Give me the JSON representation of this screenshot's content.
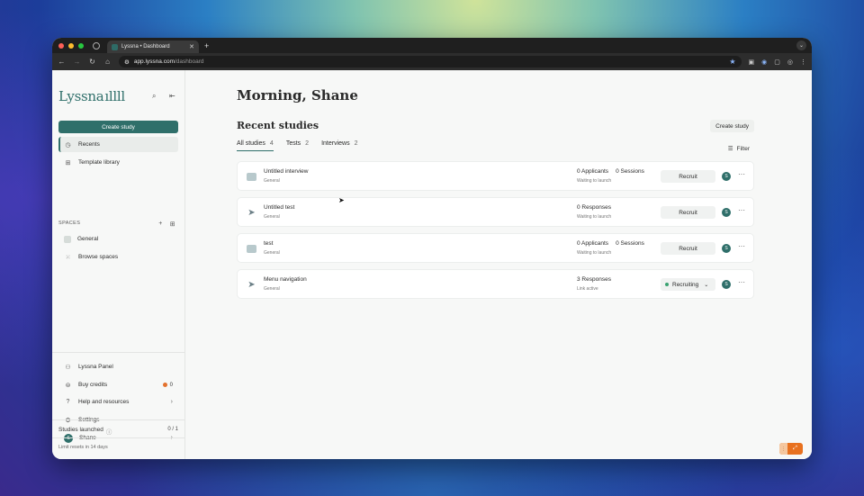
{
  "browser": {
    "tab_title": "Lyssna • Dashboard",
    "url_host": "app.lyssna.com",
    "url_path": "/dashboard"
  },
  "sidebar": {
    "logo": "Lyssna",
    "create_label": "Create study",
    "nav": [
      {
        "label": "Recents",
        "icon": "clock-icon"
      },
      {
        "label": "Template library",
        "icon": "template-icon"
      }
    ],
    "spaces_heading": "SPACES",
    "spaces": [
      {
        "label": "General"
      },
      {
        "label": "Browse spaces"
      }
    ],
    "bottom": [
      {
        "label": "Lyssna Panel"
      },
      {
        "label": "Buy credits",
        "badge": "0"
      },
      {
        "label": "Help and resources"
      },
      {
        "label": "Settings"
      },
      {
        "label": "Shane",
        "avatar": "S"
      }
    ],
    "studies_launched_label": "Studies launched",
    "studies_launched_count": "0 / 1",
    "limit_text": "Limit resets in 14 days"
  },
  "main": {
    "greeting": "Morning, Shane",
    "recent_heading": "Recent studies",
    "create_label": "Create study",
    "filter_label": "Filter",
    "tabs": [
      {
        "label": "All studies",
        "count": "4"
      },
      {
        "label": "Tests",
        "count": "2"
      },
      {
        "label": "Interviews",
        "count": "2"
      }
    ],
    "studies": [
      {
        "name": "Untitled interview",
        "space": "General",
        "stat_a": "0 Applicants",
        "stat_b": "0 Sessions",
        "status": "Waiting to launch",
        "action": "Recruit",
        "avatar": "S"
      },
      {
        "name": "Untitled test",
        "space": "General",
        "stat_a": "0 Responses",
        "stat_b": "",
        "status": "Waiting to launch",
        "action": "Recruit",
        "avatar": "S"
      },
      {
        "name": "test",
        "space": "General",
        "stat_a": "0 Applicants",
        "stat_b": "0 Sessions",
        "status": "Waiting to launch",
        "action": "Recruit",
        "avatar": "S"
      },
      {
        "name": "Menu navigation",
        "space": "General",
        "stat_a": "3 Responses",
        "stat_b": "",
        "status": "Link active",
        "action": "Recruiting",
        "avatar": "S"
      }
    ]
  }
}
